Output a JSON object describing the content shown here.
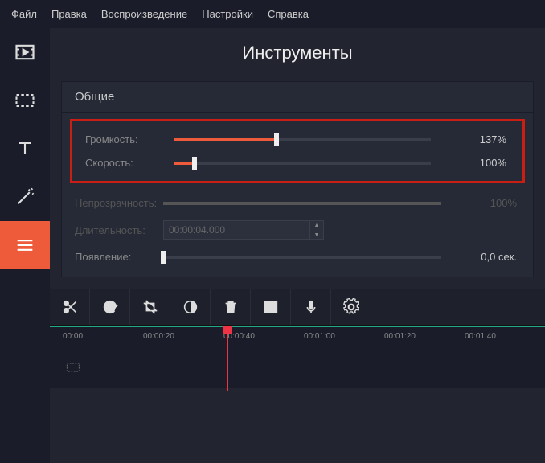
{
  "menu": {
    "file": "Файл",
    "edit": "Правка",
    "play": "Воспроизведение",
    "settings": "Настройки",
    "help": "Справка"
  },
  "title": "Инструменты",
  "panel": {
    "header": "Общие",
    "volume": {
      "label": "Громкость:",
      "value": "137%",
      "percent": 40
    },
    "speed": {
      "label": "Скорость:",
      "value": "100%",
      "percent": 8
    },
    "opacity": {
      "label": "Непрозрачность:",
      "value": "100%"
    },
    "duration": {
      "label": "Длительность:",
      "value": "00:00:04.000"
    },
    "appear": {
      "label": "Появление:",
      "value": "0,0 сек."
    }
  },
  "timeline": {
    "ticks": [
      "00:00",
      "00:00:20",
      "00:00:40",
      "00:01:00",
      "00:01:20",
      "00:01:40"
    ]
  }
}
